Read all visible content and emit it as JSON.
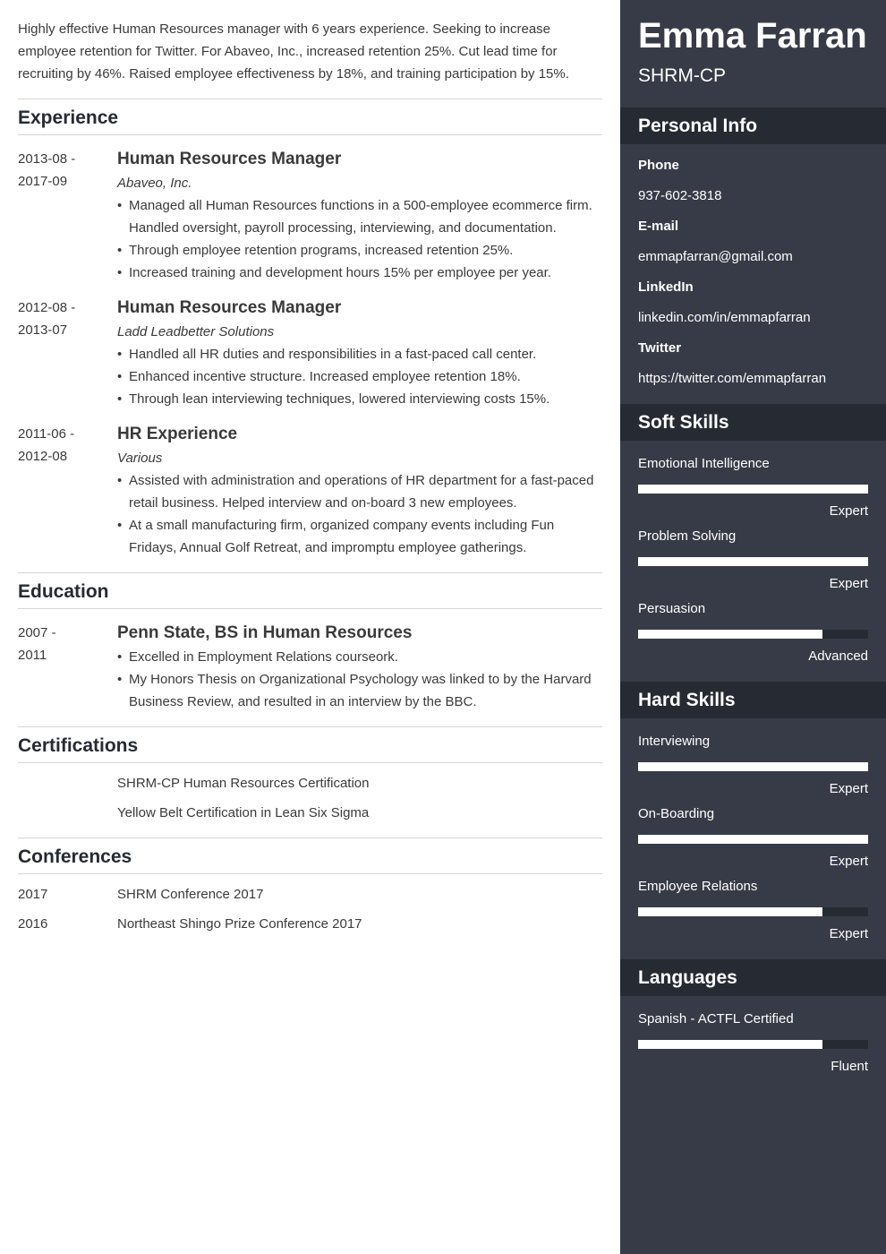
{
  "summary": "Highly effective Human Resources manager with 6 years experience. Seeking to increase employee retention for Twitter. For Abaveo, Inc., increased retention 25%. Cut lead time for recruiting by 46%. Raised employee effectiveness by 18%, and training participation by 15%.",
  "experience": {
    "heading": "Experience",
    "items": [
      {
        "date_start": "2013-08 -",
        "date_end": "2017-09",
        "title": "Human Resources Manager",
        "org": "Abaveo, Inc.",
        "bullets": [
          "Managed all Human Resources functions in a 500-employee ecommerce firm. Handled oversight, payroll processing, interviewing, and documentation.",
          "Through employee retention programs, increased retention 25%.",
          "Increased training and development hours 15% per employee per year."
        ]
      },
      {
        "date_start": "2012-08 -",
        "date_end": "2013-07",
        "title": "Human Resources Manager",
        "org": "Ladd Leadbetter Solutions",
        "bullets": [
          "Handled all HR duties and responsibilities in a fast-paced call center.",
          "Enhanced incentive structure. Increased employee retention 18%.",
          "Through lean interviewing techniques, lowered interviewing costs 15%."
        ]
      },
      {
        "date_start": "2011-06 -",
        "date_end": "2012-08",
        "title": "HR Experience",
        "org": "Various",
        "bullets": [
          "Assisted with administration and operations of HR department for a fast-paced retail business. Helped interview and on-board 3 new employees.",
          "At a small manufacturing firm, organized company events including Fun Fridays, Annual Golf Retreat, and impromptu employee gatherings."
        ]
      }
    ]
  },
  "education": {
    "heading": "Education",
    "items": [
      {
        "date_start": "2007 -",
        "date_end": "2011",
        "title": "Penn State, BS in Human Resources",
        "bullets": [
          "Excelled in Employment Relations courseork.",
          "My Honors Thesis on Organizational Psychology was linked to by the Harvard Business Review, and resulted in an interview by the BBC."
        ]
      }
    ]
  },
  "certifications": {
    "heading": "Certifications",
    "items": [
      "SHRM-CP Human Resources Certification",
      "Yellow Belt Certification in Lean Six Sigma"
    ]
  },
  "conferences": {
    "heading": "Conferences",
    "items": [
      {
        "year": "2017",
        "name": "SHRM Conference 2017"
      },
      {
        "year": "2016",
        "name": "Northeast Shingo Prize Conference 2017"
      }
    ]
  },
  "sidebar": {
    "name": "Emma Farran",
    "role": "SHRM-CP",
    "personal_info": {
      "heading": "Personal Info",
      "fields": [
        {
          "label": "Phone",
          "value": "937-602-3818"
        },
        {
          "label": "E-mail",
          "value": "emmapfarran@gmail.com"
        },
        {
          "label": "LinkedIn",
          "value": "linkedin.com/in/emmapfarran"
        },
        {
          "label": "Twitter",
          "value": "https://twitter.com/emmapfarran"
        }
      ]
    },
    "soft_skills": {
      "heading": "Soft Skills",
      "items": [
        {
          "name": "Emotional Intelligence",
          "level": "Expert",
          "fill": 1.0
        },
        {
          "name": "Problem Solving",
          "level": "Expert",
          "fill": 1.0
        },
        {
          "name": "Persuasion",
          "level": "Advanced",
          "fill": 0.8
        }
      ]
    },
    "hard_skills": {
      "heading": "Hard Skills",
      "items": [
        {
          "name": "Interviewing",
          "level": "Expert",
          "fill": 1.0
        },
        {
          "name": "On-Boarding",
          "level": "Expert",
          "fill": 1.0
        },
        {
          "name": "Employee Relations",
          "level": "Expert",
          "fill": 0.8
        }
      ]
    },
    "languages": {
      "heading": "Languages",
      "items": [
        {
          "name": "Spanish - ACTFL Certified",
          "level": "Fluent",
          "fill": 0.8
        }
      ]
    }
  },
  "colors": {
    "sidebar_bg": "#373b47",
    "sidebar_heading_bg": "#262a33",
    "bar_fill": "#ffffff",
    "bar_track": "#262a33",
    "text": "#3a3a3a",
    "heading": "#262a33"
  }
}
